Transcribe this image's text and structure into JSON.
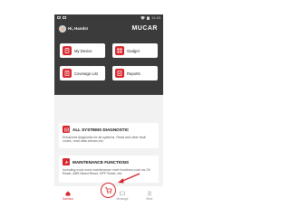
{
  "status": {
    "time": "11:43"
  },
  "header": {
    "greeting": "Hi,  Hands!",
    "logo_text": "MUCAR"
  },
  "tiles": [
    {
      "label": "My Device",
      "icon": "device-icon"
    },
    {
      "label": "Gadget",
      "icon": "gadget-icon"
    },
    {
      "label": "Coverage List",
      "icon": "coverage-icon"
    },
    {
      "label": "Reports",
      "icon": "reports-icon"
    }
  ],
  "cards": [
    {
      "title": "ALL SYSTEMS DIAGNOSTIC",
      "description": "Enhanced diagnostic for all systems. Read and clear fault codes, read data stream,etc."
    },
    {
      "title": "MAINTENANCE FUNCTIONS",
      "description": "Including most used maintenance reset functions,such as Oil Reset, ABS Bleed Reset, DPF Reset, etc."
    }
  ],
  "tabbar": {
    "items": [
      {
        "label": "Garrison",
        "icon": "home-icon"
      },
      {
        "label": "",
        "icon": "cart-icon"
      },
      {
        "label": "Message",
        "icon": "message-icon"
      },
      {
        "label": "Mine",
        "icon": "person-icon"
      }
    ]
  },
  "colors": {
    "accent": "#d7262e",
    "hero_bg": "#3b3b3b",
    "page_bg": "#f2f2f2"
  }
}
